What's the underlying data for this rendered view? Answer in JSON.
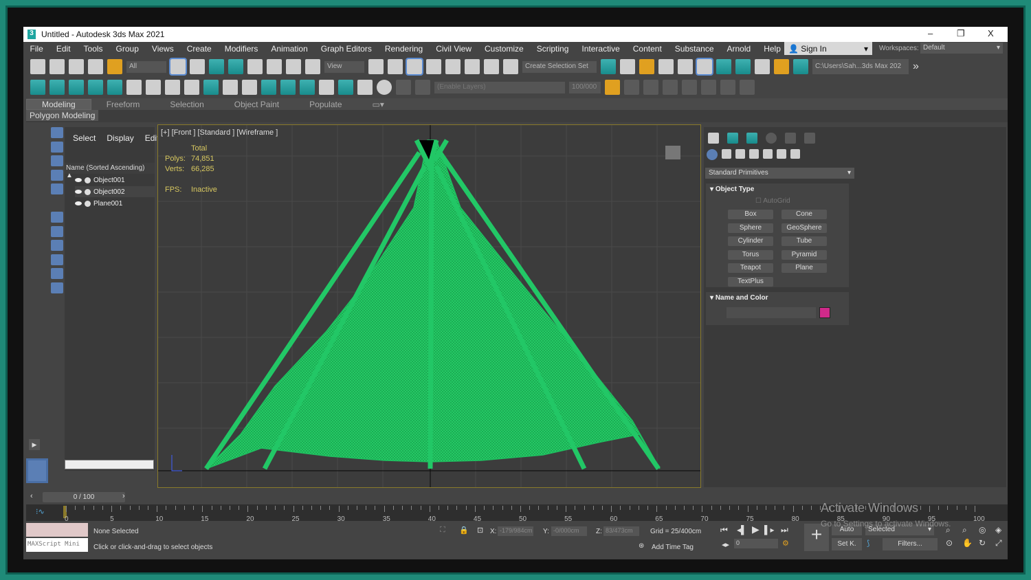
{
  "window": {
    "title": "Untitled - Autodesk 3ds Max 2021",
    "minimize": "–",
    "restore": "❐",
    "close": "X"
  },
  "menu": [
    "File",
    "Edit",
    "Tools",
    "Group",
    "Views",
    "Create",
    "Modifiers",
    "Animation",
    "Graph Editors",
    "Rendering",
    "Civil View",
    "Customize",
    "Scripting",
    "Interactive",
    "Content",
    "Substance",
    "Arnold",
    "Help"
  ],
  "signin": "Sign In",
  "workspaces_label": "Workspaces:",
  "workspace": "Default",
  "toolbar": {
    "filter": "All",
    "ref_coord": "View",
    "selection_set": "Create Selection Set",
    "project_path": "C:\\Users\\Sah...3ds Max 202",
    "layers": "(Enable Layers)",
    "layer_value": "100/000"
  },
  "ribbon": {
    "tabs": [
      "Modeling",
      "Freeform",
      "Selection",
      "Object Paint",
      "Populate"
    ],
    "active": "Modeling",
    "panel": "Polygon Modeling"
  },
  "scene_explorer": {
    "tabs": [
      "Select",
      "Display",
      "Edit"
    ],
    "column": "Name (Sorted Ascending)",
    "items": [
      "Object001",
      "Object002",
      "Plane001"
    ]
  },
  "viewport": {
    "label": "[+] [Front ] [Standard ] [Wireframe ]",
    "stats_header": "Total",
    "polys_label": "Polys:",
    "polys": "74,851",
    "verts_label": "Verts:",
    "verts": "66,285",
    "fps_label": "FPS:",
    "fps": "Inactive",
    "wire_color": "#1fc060"
  },
  "command_panel": {
    "category": "Standard Primitives",
    "object_type_title": "Object Type",
    "autogrid": "AutoGrid",
    "buttons": [
      "Box",
      "Cone",
      "Sphere",
      "GeoSphere",
      "Cylinder",
      "Tube",
      "Torus",
      "Pyramid",
      "Teapot",
      "Plane",
      "TextPlus"
    ],
    "name_color_title": "Name and Color",
    "object_color": "#d02a8a"
  },
  "timeline": {
    "frame": "0 / 100",
    "ticks": [
      "0",
      "5",
      "10",
      "15",
      "20",
      "25",
      "30",
      "35",
      "40",
      "45",
      "50",
      "55",
      "60",
      "65",
      "70",
      "75",
      "80",
      "85",
      "90",
      "95",
      "100"
    ]
  },
  "status": {
    "maxscript": "MAXScript Mini",
    "selection": "None Selected",
    "prompt": "Click or click-and-drag to select objects",
    "x_label": "X:",
    "x": "-179/984cm",
    "y_label": "Y:",
    "y": "-0/000cm",
    "z_label": "Z:",
    "z": "83/473cm",
    "grid": "Grid = 25/400cm",
    "add_time_tag": "Add Time Tag",
    "auto": "Auto",
    "set_key": "Set K.",
    "key_mode": "Selected",
    "filters": "Filters...",
    "frame_value": "0"
  },
  "watermark": {
    "line1": "Activate Windows",
    "line2": "Go to Settings to activate Windows."
  }
}
